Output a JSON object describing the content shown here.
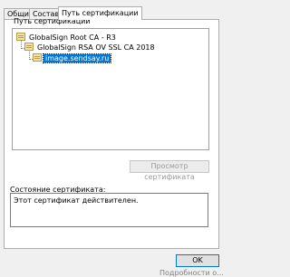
{
  "tabs": [
    "Общие",
    "Состав",
    "Путь сертификации"
  ],
  "active_tab": "Путь сертификации",
  "path_group_label": "Путь сертификации",
  "tree": [
    {
      "label": "GlobalSign Root CA - R3",
      "selected": false
    },
    {
      "label": "GlobalSign RSA OV SSL CA 2018",
      "selected": false
    },
    {
      "label": "image.sendsay.ru",
      "selected": true
    }
  ],
  "view_cert_button": "Просмотр сертификата",
  "status_label": "Состояние сертификата:",
  "status_text": "Этот сертификат действителен.",
  "ok_button": "OK",
  "bottom_cut_text": "Подробности о..."
}
